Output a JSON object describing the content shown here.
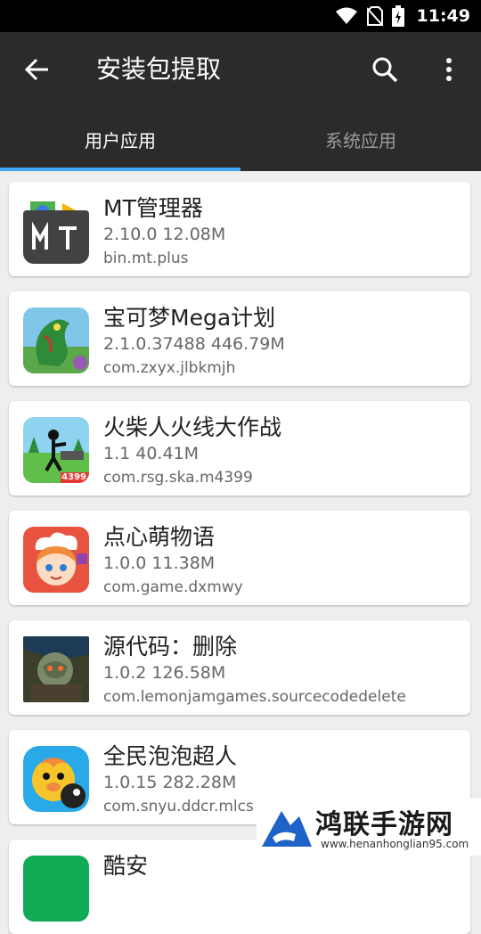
{
  "status": {
    "time": "11:49"
  },
  "appbar": {
    "title": "安装包提取"
  },
  "tabs": [
    {
      "label": "用户应用"
    },
    {
      "label": "系统应用"
    }
  ],
  "apps": [
    {
      "name": "MT管理器",
      "meta": "2.10.0   12.08M",
      "package": "bin.mt.plus"
    },
    {
      "name": "宝可梦Mega计划",
      "meta": "2.1.0.37488   446.79M",
      "package": "com.zxyx.jlbkmjh"
    },
    {
      "name": "火柴人火线大作战",
      "meta": "1.1   40.41M",
      "package": "com.rsg.ska.m4399"
    },
    {
      "name": "点心萌物语",
      "meta": "1.0.0   11.38M",
      "package": "com.game.dxmwy"
    },
    {
      "name": "源代码：删除",
      "meta": "1.0.2   126.58M",
      "package": "com.lemonjamgames.sourcecodedelete"
    },
    {
      "name": "全民泡泡超人",
      "meta": "1.0.15   282.28M",
      "package": "com.snyu.ddcr.mlcs"
    },
    {
      "name": "酷安",
      "meta": "",
      "package": ""
    }
  ],
  "icons": {
    "mt": {
      "text": "MT",
      "badge": ""
    },
    "stickman": {
      "badge": "4399"
    }
  },
  "watermark": {
    "text": "鸿联手游网",
    "url": "www.henanhonglian95.com"
  }
}
